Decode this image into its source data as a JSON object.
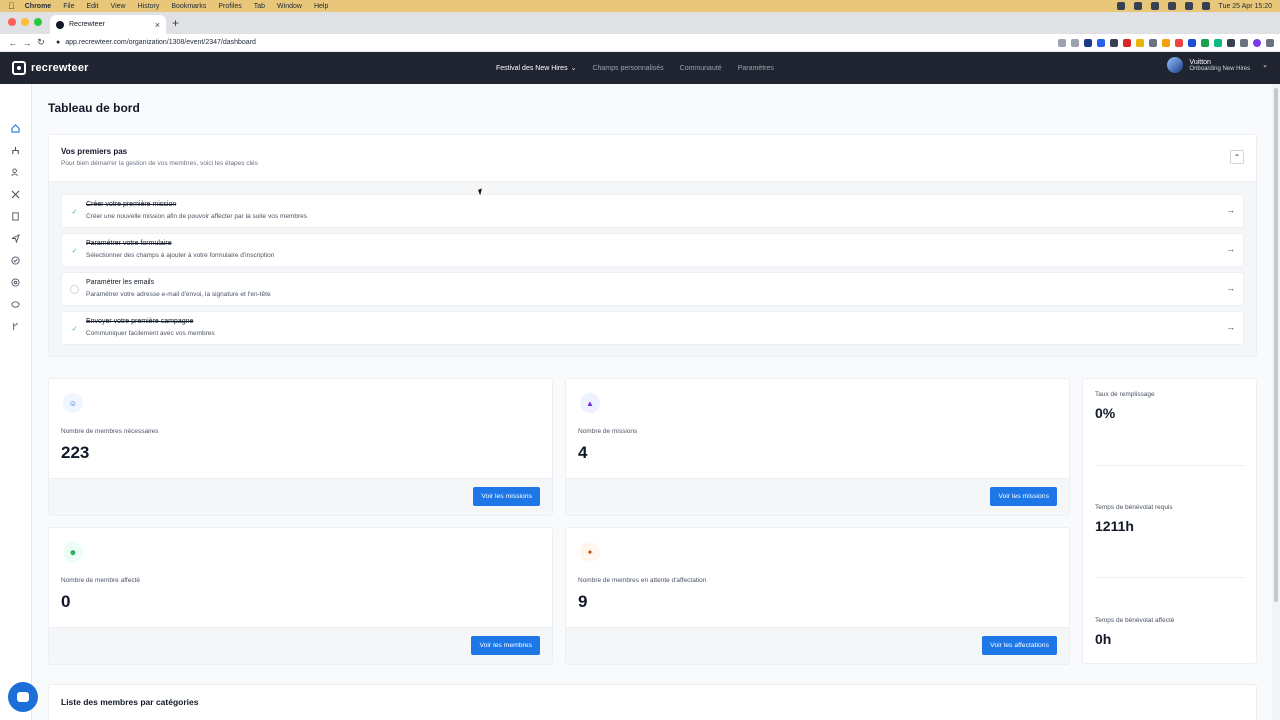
{
  "mac": {
    "menu": [
      "Chrome",
      "File",
      "Edit",
      "View",
      "History",
      "Bookmarks",
      "Profiles",
      "Tab",
      "Window",
      "Help"
    ],
    "clock": "Tue 25 Apr  15:20"
  },
  "browser": {
    "tab_title": "Recrewteer",
    "url": "app.recrewteer.com/organization/1308/event/2347/dashboard"
  },
  "header": {
    "brand": "recrewteer",
    "nav": {
      "event": "Festival des New Hires",
      "fields": "Champs personnalisés",
      "community": "Communauté",
      "settings": "Paramètres"
    },
    "user": {
      "name": "Vuitton",
      "subtitle": "Onboarding New Hires"
    }
  },
  "page": {
    "title": "Tableau de bord"
  },
  "steps": {
    "title": "Vos premiers pas",
    "subtitle": "Pour bien démarrer la gestion de vos membres, voici les étapes clés",
    "items": [
      {
        "title": "Créer votre première mission",
        "desc": "Créer une nouvelle mission afin de pouvoir affecter par la suite vos membres",
        "done": true
      },
      {
        "title": "Paramétrer votre formulaire",
        "desc": "Sélectionner des champs à ajouter à votre formulaire d'inscription",
        "done": true
      },
      {
        "title": "Paramétrer les emails",
        "desc": "Paramétrer votre adresse e-mail d'envoi, la signature et l'en-tête",
        "done": false
      },
      {
        "title": "Envoyer votre première campagne",
        "desc": "Communiquer facilement avec vos membres",
        "done": true
      }
    ]
  },
  "stats": {
    "members_needed": {
      "label": "Nombre de membres nécessaires",
      "value": "223",
      "button": "Voir les missions"
    },
    "missions": {
      "label": "Nombre de missions",
      "value": "4",
      "button": "Voir les missions"
    },
    "members_assigned": {
      "label": "Nombre de membre affecté",
      "value": "0",
      "button": "Voir les membres"
    },
    "members_pending": {
      "label": "Nombre de membres en attente d'affectation",
      "value": "9",
      "button": "Voir les affectations"
    }
  },
  "side_stats": {
    "fill_rate": {
      "label": "Taux de remplissage",
      "value": "0%"
    },
    "required_time": {
      "label": "Temps de bénévolat requis",
      "value": "1211h"
    },
    "assigned_time": {
      "label": "Temps de bénévolat affecté",
      "value": "0h"
    }
  },
  "list": {
    "title": "Liste des membres par catégories"
  },
  "colors": {
    "primary": "#1d77e6",
    "header_bg": "#1f2430",
    "success": "#22c55e"
  }
}
